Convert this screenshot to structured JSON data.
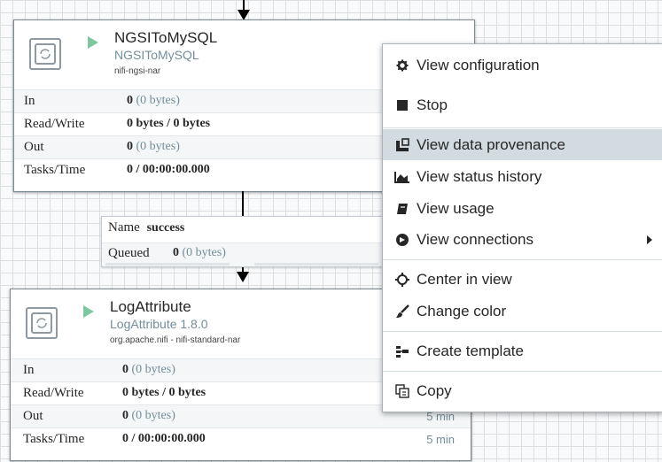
{
  "processor1": {
    "name": "NGSIToMySQL",
    "type": "NGSIToMySQL",
    "bundle": "nifi-ngsi-nar",
    "stats": [
      {
        "label": "In",
        "bold": "0",
        "dim": "(0 bytes)"
      },
      {
        "label": "Read/Write",
        "bold": "0 bytes / 0 bytes",
        "dim": ""
      },
      {
        "label": "Out",
        "bold": "0",
        "dim": "(0 bytes)"
      },
      {
        "label": "Tasks/Time",
        "bold": "0 / 00:00:00.000",
        "dim": ""
      }
    ]
  },
  "connection": {
    "name_label": "Name",
    "name_value": "success",
    "queued_label": "Queued",
    "queued_bold": "0",
    "queued_dim": "(0 bytes)"
  },
  "processor2": {
    "name": "LogAttribute",
    "type": "LogAttribute 1.8.0",
    "bundle": "org.apache.nifi - nifi-standard-nar",
    "stats": [
      {
        "label": "In",
        "bold": "0",
        "dim": "(0 bytes)",
        "time": ""
      },
      {
        "label": "Read/Write",
        "bold": "0 bytes / 0 bytes",
        "dim": "",
        "time": ""
      },
      {
        "label": "Out",
        "bold": "0",
        "dim": "(0 bytes)",
        "time": "5 min"
      },
      {
        "label": "Tasks/Time",
        "bold": "0 / 00:00:00.000",
        "dim": "",
        "time": "5 min"
      }
    ]
  },
  "context_menu": {
    "items": [
      {
        "label": "View configuration",
        "icon": "gear-icon"
      },
      {
        "label": "Stop",
        "icon": "stop-icon"
      },
      {
        "label": "View data provenance",
        "icon": "provenance-icon"
      },
      {
        "label": "View status history",
        "icon": "chart-icon"
      },
      {
        "label": "View usage",
        "icon": "book-icon"
      },
      {
        "label": "View connections",
        "icon": "connections-icon"
      },
      {
        "label": "Center in view",
        "icon": "crosshair-icon"
      },
      {
        "label": "Change color",
        "icon": "paintbrush-icon"
      },
      {
        "label": "Create template",
        "icon": "template-icon"
      },
      {
        "label": "Copy",
        "icon": "copy-icon"
      }
    ],
    "hovered_item": "View data provenance"
  },
  "colors": {
    "run_green": "#7dc7a0",
    "type_blue": "#728e9b",
    "menu_hover": "#d1dbe0"
  }
}
